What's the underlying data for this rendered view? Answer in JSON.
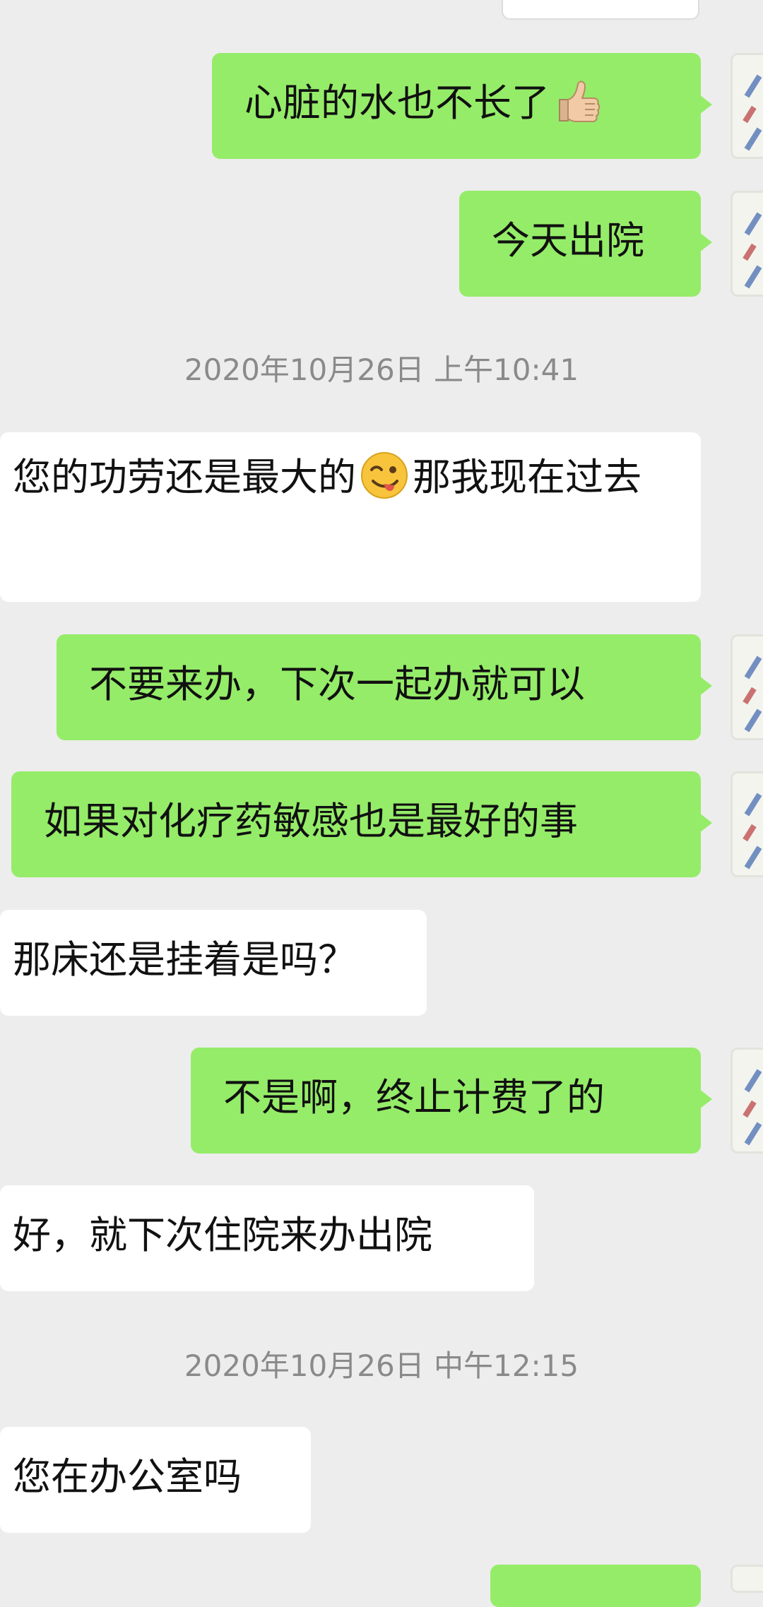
{
  "messages": [
    {
      "side": "out",
      "text": "心脏的水也不长了",
      "emoji": "thumbs-up"
    },
    {
      "side": "out",
      "text": "今天出院"
    },
    {
      "side": "time",
      "text": "2020年10月26日 上午10:41"
    },
    {
      "side": "in",
      "text_before": "您的功劳还是最大的",
      "emoji": "winking-face-tongue",
      "text_after": "那我现在过去"
    },
    {
      "side": "out",
      "text": "不要来办，下次一起办就可以"
    },
    {
      "side": "out",
      "text": "如果对化疗药敏感也是最好的事"
    },
    {
      "side": "in",
      "text": "那床还是挂着是吗？"
    },
    {
      "side": "out",
      "text": "不是啊，终止计费了的"
    },
    {
      "side": "in",
      "text": "好，就下次住院来办出院"
    },
    {
      "side": "time",
      "text": "2020年10月26日 中午12:15"
    },
    {
      "side": "in",
      "text": "您在办公室吗"
    }
  ],
  "colors": {
    "background": "#ededed",
    "outgoing_bubble": "#95ec69",
    "incoming_bubble": "#ffffff",
    "timestamp_text": "#8a8a8a"
  }
}
